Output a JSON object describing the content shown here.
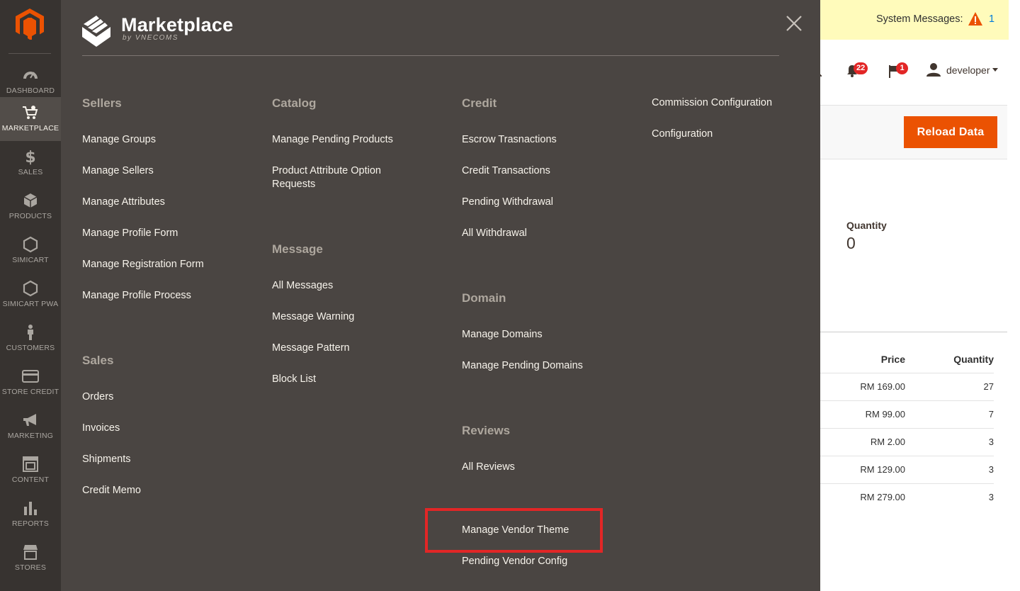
{
  "sidebar": {
    "items": [
      {
        "label": "DASHBOARD",
        "icon": "dashboard-icon"
      },
      {
        "label": "MARKETPLACE",
        "icon": "cart-gear-icon",
        "active": true
      },
      {
        "label": "SALES",
        "icon": "dollar-icon"
      },
      {
        "label": "PRODUCTS",
        "icon": "box-icon"
      },
      {
        "label": "SIMICART",
        "icon": "hexagon-icon"
      },
      {
        "label": "SIMICART PWA",
        "icon": "hexagon-icon"
      },
      {
        "label": "CUSTOMERS",
        "icon": "person-icon"
      },
      {
        "label": "STORE CREDIT",
        "icon": "credit-card-icon"
      },
      {
        "label": "MARKETING",
        "icon": "megaphone-icon"
      },
      {
        "label": "CONTENT",
        "icon": "layout-icon"
      },
      {
        "label": "REPORTS",
        "icon": "bar-chart-icon"
      },
      {
        "label": "STORES",
        "icon": "store-icon"
      }
    ]
  },
  "panel": {
    "title": "Marketplace",
    "subtitle": "by VNECOMS",
    "columns": {
      "col1": {
        "sections": [
          {
            "title": "Sellers",
            "links": [
              "Manage Groups",
              "Manage Sellers",
              "Manage Attributes",
              "Manage Profile Form",
              "Manage Registration Form",
              "Manage Profile Process"
            ]
          },
          {
            "title": "Sales",
            "links": [
              "Orders",
              "Invoices",
              "Shipments",
              "Credit Memo"
            ]
          }
        ]
      },
      "col2": {
        "sections": [
          {
            "title": "Catalog",
            "links": [
              "Manage Pending Products",
              "Product Attribute Option Requests"
            ]
          },
          {
            "title": "Message",
            "links": [
              "All Messages",
              "Message Warning",
              "Message Pattern",
              "Block List"
            ]
          }
        ]
      },
      "col3": {
        "sections": [
          {
            "title": "Credit",
            "links": [
              "Escrow Trasnactions",
              "Credit Transactions",
              "Pending Withdrawal",
              "All Withdrawal"
            ]
          },
          {
            "title": "Domain",
            "links": [
              "Manage Domains",
              "Manage Pending Domains"
            ]
          },
          {
            "title": "Reviews",
            "links": [
              "All Reviews"
            ]
          }
        ],
        "extra_links": [
          "Manage Vendor Theme",
          "Pending Vendor Config"
        ]
      },
      "col4": {
        "links": [
          "Commission Configuration",
          "Configuration"
        ]
      }
    }
  },
  "header": {
    "system_messages_label": "System Messages:",
    "system_messages_count": "1",
    "notifications_count": "22",
    "flags_count": "1",
    "user_name": "developer"
  },
  "actions": {
    "reload_label": "Reload Data"
  },
  "stats": {
    "quantity_label": "Quantity",
    "quantity_value": "0"
  },
  "table": {
    "headers": [
      "Price",
      "Quantity"
    ],
    "rows": [
      [
        "RM 169.00",
        "27"
      ],
      [
        "RM 99.00",
        "7"
      ],
      [
        "RM 2.00",
        "3"
      ],
      [
        "RM 129.00",
        "3"
      ],
      [
        "RM 279.00",
        "3"
      ]
    ]
  },
  "colors": {
    "sidebar_bg": "#373330",
    "panel_bg": "#4a4542",
    "accent": "#eb5202",
    "highlight": "#e22626",
    "sysmsg_bg": "#fffbbb"
  }
}
